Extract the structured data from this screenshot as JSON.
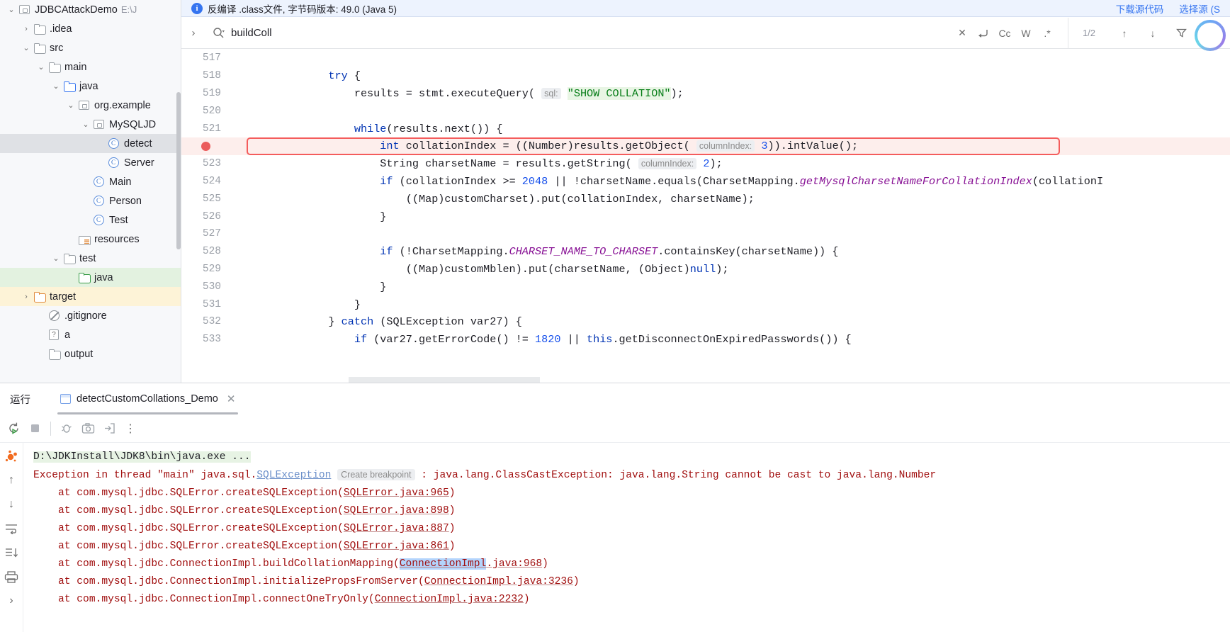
{
  "project_tree": {
    "items": [
      {
        "label": "JDBCAttackDemo",
        "suffix": "E:\\J",
        "icon": "module-icon",
        "depth": 0,
        "chevron": "down",
        "state": "none"
      },
      {
        "label": ".idea",
        "icon": "folder-icon",
        "depth": 1,
        "chevron": "right",
        "state": "none"
      },
      {
        "label": "src",
        "icon": "folder-icon",
        "depth": 1,
        "chevron": "down",
        "state": "none"
      },
      {
        "label": "main",
        "icon": "folder-icon",
        "depth": 2,
        "chevron": "down",
        "state": "none"
      },
      {
        "label": "java",
        "icon": "folder-blue-icon",
        "depth": 3,
        "chevron": "down",
        "state": "none"
      },
      {
        "label": "org.example",
        "icon": "package-icon",
        "depth": 4,
        "chevron": "down",
        "state": "none"
      },
      {
        "label": "MySQLJD",
        "icon": "package-icon",
        "depth": 5,
        "chevron": "down",
        "state": "none"
      },
      {
        "label": "detect",
        "icon": "class-icon",
        "depth": 6,
        "chevron": "none",
        "state": "selected-grey"
      },
      {
        "label": "Server",
        "icon": "class-icon",
        "depth": 6,
        "chevron": "none",
        "state": "none"
      },
      {
        "label": "Main",
        "icon": "class-icon",
        "depth": 5,
        "chevron": "none",
        "state": "none"
      },
      {
        "label": "Person",
        "icon": "class-icon",
        "depth": 5,
        "chevron": "none",
        "state": "none"
      },
      {
        "label": "Test",
        "icon": "class-icon",
        "depth": 5,
        "chevron": "none",
        "state": "none"
      },
      {
        "label": "resources",
        "icon": "resources-icon",
        "depth": 4,
        "chevron": "none",
        "state": "none"
      },
      {
        "label": "test",
        "icon": "folder-icon",
        "depth": 3,
        "chevron": "down",
        "state": "none"
      },
      {
        "label": "java",
        "icon": "folder-green-icon",
        "depth": 4,
        "chevron": "none",
        "state": "selected-green"
      },
      {
        "label": "target",
        "icon": "folder-orange-icon",
        "depth": 1,
        "chevron": "right",
        "state": "selected-yellow"
      },
      {
        "label": ".gitignore",
        "icon": "gitignore-icon",
        "depth": 2,
        "chevron": "none",
        "state": "none"
      },
      {
        "label": "a",
        "icon": "unknown-file-icon",
        "depth": 2,
        "chevron": "none",
        "state": "none"
      },
      {
        "label": "output",
        "icon": "folder-icon",
        "depth": 2,
        "chevron": "none",
        "state": "none"
      }
    ]
  },
  "notification": {
    "text": "反编译 .class文件, 字节码版本: 49.0 (Java 5)",
    "link_download": "下载源代码",
    "link_choose": "选择源 (S"
  },
  "findbar": {
    "query": "buildColl",
    "placeholder": "Search",
    "match_count": "1/2",
    "opt_cc": "Cc",
    "opt_w": "W",
    "opt_regex": ".*"
  },
  "editor": {
    "lines": [
      {
        "num": "517",
        "segments": [
          {
            "t": "",
            "c": ""
          }
        ],
        "highlight": false,
        "breakpoint": false
      },
      {
        "num": "518",
        "indent": 12,
        "segments": [
          {
            "t": "try",
            "c": "kw"
          },
          {
            "t": " {",
            "c": ""
          }
        ],
        "highlight": false,
        "breakpoint": false
      },
      {
        "num": "519",
        "indent": 16,
        "segments": [
          {
            "t": "results = stmt.executeQuery( ",
            "c": ""
          },
          {
            "t": "sql:",
            "c": "hint"
          },
          {
            "t": " ",
            "c": ""
          },
          {
            "t": "\"SHOW COLLATION\"",
            "c": "str"
          },
          {
            "t": ");",
            "c": ""
          }
        ],
        "highlight": false,
        "breakpoint": false
      },
      {
        "num": "520",
        "segments": [
          {
            "t": "",
            "c": ""
          }
        ],
        "highlight": false,
        "breakpoint": false
      },
      {
        "num": "521",
        "indent": 16,
        "segments": [
          {
            "t": "while",
            "c": "kw"
          },
          {
            "t": "(results.next()) {",
            "c": ""
          }
        ],
        "highlight": false,
        "breakpoint": false
      },
      {
        "num": "",
        "indent": 20,
        "segments": [
          {
            "t": "int",
            "c": "kw"
          },
          {
            "t": " collationIndex = ((Number)results.getObject( ",
            "c": ""
          },
          {
            "t": "columnIndex:",
            "c": "hint"
          },
          {
            "t": " ",
            "c": ""
          },
          {
            "t": "3",
            "c": "num"
          },
          {
            "t": ")).intValue();",
            "c": ""
          }
        ],
        "highlight": true,
        "breakpoint": true
      },
      {
        "num": "523",
        "indent": 20,
        "segments": [
          {
            "t": "String charsetName = results.getString( ",
            "c": ""
          },
          {
            "t": "columnIndex:",
            "c": "hint"
          },
          {
            "t": " ",
            "c": ""
          },
          {
            "t": "2",
            "c": "num"
          },
          {
            "t": ");",
            "c": ""
          }
        ],
        "highlight": false,
        "breakpoint": false
      },
      {
        "num": "524",
        "indent": 20,
        "segments": [
          {
            "t": "if",
            "c": "kw"
          },
          {
            "t": " (collationIndex >= ",
            "c": ""
          },
          {
            "t": "2048",
            "c": "num"
          },
          {
            "t": " || !charsetName.equals(CharsetMapping.",
            "c": ""
          },
          {
            "t": "getMysqlCharsetNameForCollationIndex",
            "c": "stat"
          },
          {
            "t": "(collationI",
            "c": ""
          }
        ],
        "highlight": false,
        "breakpoint": false
      },
      {
        "num": "525",
        "indent": 24,
        "segments": [
          {
            "t": "((Map)customCharset).put(collationIndex, charsetName);",
            "c": ""
          }
        ],
        "highlight": false,
        "breakpoint": false
      },
      {
        "num": "526",
        "indent": 20,
        "segments": [
          {
            "t": "}",
            "c": ""
          }
        ],
        "highlight": false,
        "breakpoint": false
      },
      {
        "num": "527",
        "segments": [
          {
            "t": "",
            "c": ""
          }
        ],
        "highlight": false,
        "breakpoint": false
      },
      {
        "num": "528",
        "indent": 20,
        "segments": [
          {
            "t": "if",
            "c": "kw"
          },
          {
            "t": " (!CharsetMapping.",
            "c": ""
          },
          {
            "t": "CHARSET_NAME_TO_CHARSET",
            "c": "stat"
          },
          {
            "t": ".containsKey(charsetName)) {",
            "c": ""
          }
        ],
        "highlight": false,
        "breakpoint": false
      },
      {
        "num": "529",
        "indent": 24,
        "segments": [
          {
            "t": "((Map)customMblen).put(charsetName, (Object)",
            "c": ""
          },
          {
            "t": "null",
            "c": "kw"
          },
          {
            "t": ");",
            "c": ""
          }
        ],
        "highlight": false,
        "breakpoint": false
      },
      {
        "num": "530",
        "indent": 20,
        "segments": [
          {
            "t": "}",
            "c": ""
          }
        ],
        "highlight": false,
        "breakpoint": false
      },
      {
        "num": "531",
        "indent": 16,
        "segments": [
          {
            "t": "}",
            "c": ""
          }
        ],
        "highlight": false,
        "breakpoint": false
      },
      {
        "num": "532",
        "indent": 12,
        "segments": [
          {
            "t": "} ",
            "c": ""
          },
          {
            "t": "catch",
            "c": "kw"
          },
          {
            "t": " (SQLException var27) {",
            "c": ""
          }
        ],
        "highlight": false,
        "breakpoint": false
      },
      {
        "num": "533",
        "indent": 16,
        "segments": [
          {
            "t": "if",
            "c": "kw"
          },
          {
            "t": " (var27.getErrorCode() != ",
            "c": ""
          },
          {
            "t": "1820",
            "c": "num"
          },
          {
            "t": " || ",
            "c": ""
          },
          {
            "t": "this",
            "c": "kw"
          },
          {
            "t": ".getDisconnectOnExpiredPasswords()) {",
            "c": ""
          }
        ],
        "highlight": false,
        "breakpoint": false
      }
    ]
  },
  "run_panel": {
    "title": "运行",
    "tab_label": "detectCustomCollations_Demo",
    "console_lines": [
      {
        "style": "green",
        "segments": [
          {
            "t": "D:\\JDKInstall\\JDK8\\bin\\java.exe ...",
            "c": ""
          }
        ]
      },
      {
        "style": "red",
        "segments": [
          {
            "t": "Exception in thread \"main\" java.sql.",
            "c": "c-red"
          },
          {
            "t": "SQLException",
            "c": "c-link"
          },
          {
            "t": " ",
            "c": ""
          },
          {
            "t": "Create breakpoint",
            "c": "c-chip"
          },
          {
            "t": " : java.lang.ClassCastException: java.lang.String cannot be cast to java.lang.Number",
            "c": "c-red"
          }
        ]
      },
      {
        "style": "red",
        "segments": [
          {
            "t": "    at com.mysql.jdbc.SQLError.createSQLException(",
            "c": "c-red"
          },
          {
            "t": "SQLError.java:965",
            "c": "c-linkred"
          },
          {
            "t": ")",
            "c": "c-red"
          }
        ]
      },
      {
        "style": "red",
        "segments": [
          {
            "t": "    at com.mysql.jdbc.SQLError.createSQLException(",
            "c": "c-red"
          },
          {
            "t": "SQLError.java:898",
            "c": "c-linkred"
          },
          {
            "t": ")",
            "c": "c-red"
          }
        ]
      },
      {
        "style": "red",
        "segments": [
          {
            "t": "    at com.mysql.jdbc.SQLError.createSQLException(",
            "c": "c-red"
          },
          {
            "t": "SQLError.java:887",
            "c": "c-linkred"
          },
          {
            "t": ")",
            "c": "c-red"
          }
        ]
      },
      {
        "style": "red",
        "segments": [
          {
            "t": "    at com.mysql.jdbc.SQLError.createSQLException(",
            "c": "c-red"
          },
          {
            "t": "SQLError.java:861",
            "c": "c-linkred"
          },
          {
            "t": ")",
            "c": "c-red"
          }
        ]
      },
      {
        "style": "red",
        "segments": [
          {
            "t": "    at com.mysql.jdbc.ConnectionImpl.buildCollationMapping(",
            "c": "c-red"
          },
          {
            "t": "ConnectionImpl",
            "c": "c-linkred c-hl"
          },
          {
            "t": ".java:968",
            "c": "c-linkred"
          },
          {
            "t": ")",
            "c": "c-red"
          }
        ]
      },
      {
        "style": "red",
        "segments": [
          {
            "t": "    at com.mysql.jdbc.ConnectionImpl.initializePropsFromServer(",
            "c": "c-red"
          },
          {
            "t": "ConnectionImpl.java:3236",
            "c": "c-linkred"
          },
          {
            "t": ")",
            "c": "c-red"
          }
        ]
      },
      {
        "style": "red",
        "segments": [
          {
            "t": "    at com.mysql.jdbc.ConnectionImpl.connectOneTryOnly(",
            "c": "c-red"
          },
          {
            "t": "ConnectionImpl.java:2232",
            "c": "c-linkred"
          },
          {
            "t": ")",
            "c": "c-red"
          }
        ]
      }
    ]
  },
  "colors": {
    "accent_blue": "#3574f0",
    "error_red": "#a11010",
    "highlight_red": "#f45c5c",
    "string_green": "#067d17",
    "keyword_blue": "#0033b3"
  }
}
